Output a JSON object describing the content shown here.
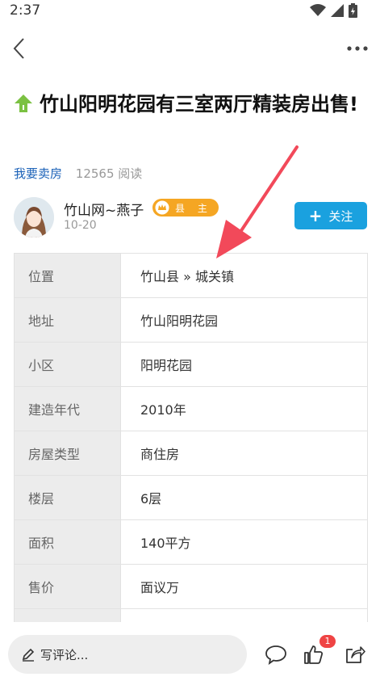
{
  "status": {
    "time": "2:37"
  },
  "article": {
    "title": "竹山阳明花园有三室两厅精装房出售!",
    "category": "我要卖房",
    "reads": "12565 阅读"
  },
  "author": {
    "name": "竹山网~燕子",
    "badge": "县 主",
    "date": "10-20",
    "follow_label": "关注"
  },
  "details": [
    {
      "label": "位置",
      "value": "竹山县 » 城关镇"
    },
    {
      "label": "地址",
      "value": "竹山阳明花园"
    },
    {
      "label": "小区",
      "value": "阳明花园"
    },
    {
      "label": "建造年代",
      "value": "2010年"
    },
    {
      "label": "房屋类型",
      "value": "商住房"
    },
    {
      "label": "楼层",
      "value": "6层"
    },
    {
      "label": "面积",
      "value": "140平方"
    },
    {
      "label": "售价",
      "value": "面议万"
    },
    {
      "label": "",
      "value": ""
    }
  ],
  "bottom": {
    "comment_placeholder": "写评论...",
    "like_count": "1"
  },
  "colors": {
    "accent": "#1aa1df",
    "link": "#1b62b8",
    "badge": "#f5a623",
    "arrow": "#f2495a",
    "up_icon": "#7bc142"
  },
  "icons": [
    "back-icon",
    "more-icon",
    "up-arrow-icon",
    "wifi-icon",
    "signal-icon",
    "battery-icon",
    "pencil-icon",
    "comment-icon",
    "like-icon",
    "share-icon"
  ]
}
